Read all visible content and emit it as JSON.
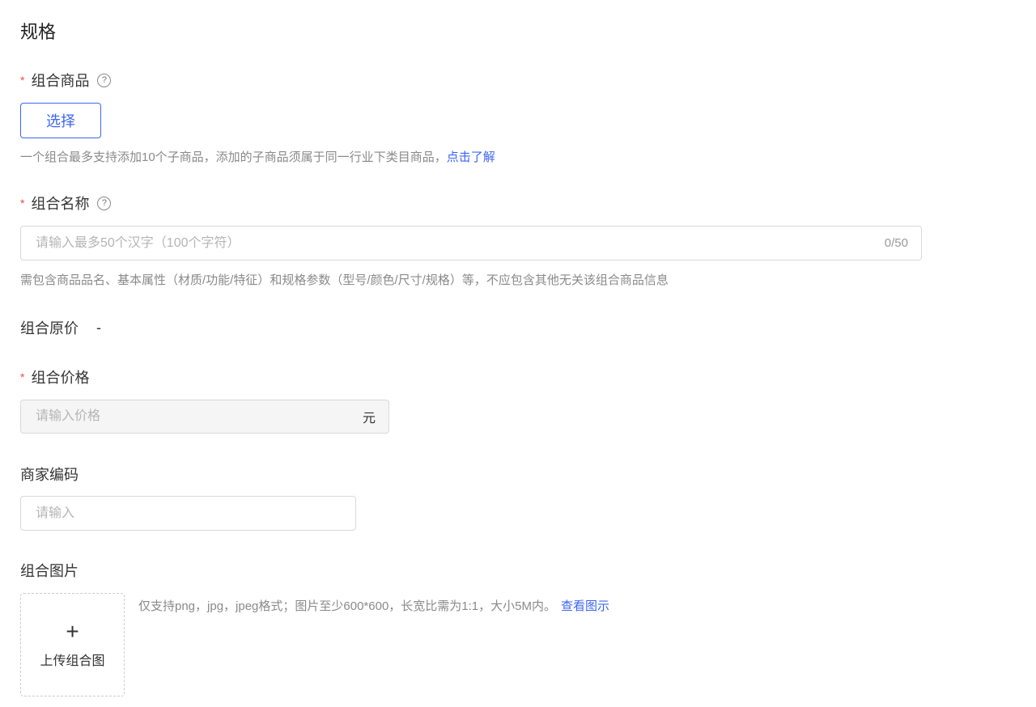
{
  "section_title": "规格",
  "combo_products": {
    "label": "组合商品",
    "required_mark": "*",
    "help_icon": "question-circle-icon",
    "select_button": "选择",
    "hint": "一个组合最多支持添加10个子商品，添加的子商品须属于同一行业下类目商品，",
    "hint_link": "点击了解"
  },
  "combo_name": {
    "label": "组合名称",
    "required_mark": "*",
    "placeholder": "请输入最多50个汉字（100个字符）",
    "counter": "0/50",
    "hint": "需包含商品品名、基本属性（材质/功能/特征）和规格参数（型号/颜色/尺寸/规格）等，不应包含其他无关该组合商品信息"
  },
  "original_price": {
    "label": "组合原价",
    "value": "-"
  },
  "combo_price": {
    "label": "组合价格",
    "required_mark": "*",
    "placeholder": "请输入价格",
    "suffix": "元"
  },
  "merchant_code": {
    "label": "商家编码",
    "placeholder": "请输入"
  },
  "combo_image": {
    "label": "组合图片",
    "upload_icon": "plus",
    "upload_label": "上传组合图",
    "hint": "仅支持png，jpg，jpeg格式；图片至少600*600，长宽比需为1:1，大小5M内。",
    "hint_link": "查看图示"
  }
}
